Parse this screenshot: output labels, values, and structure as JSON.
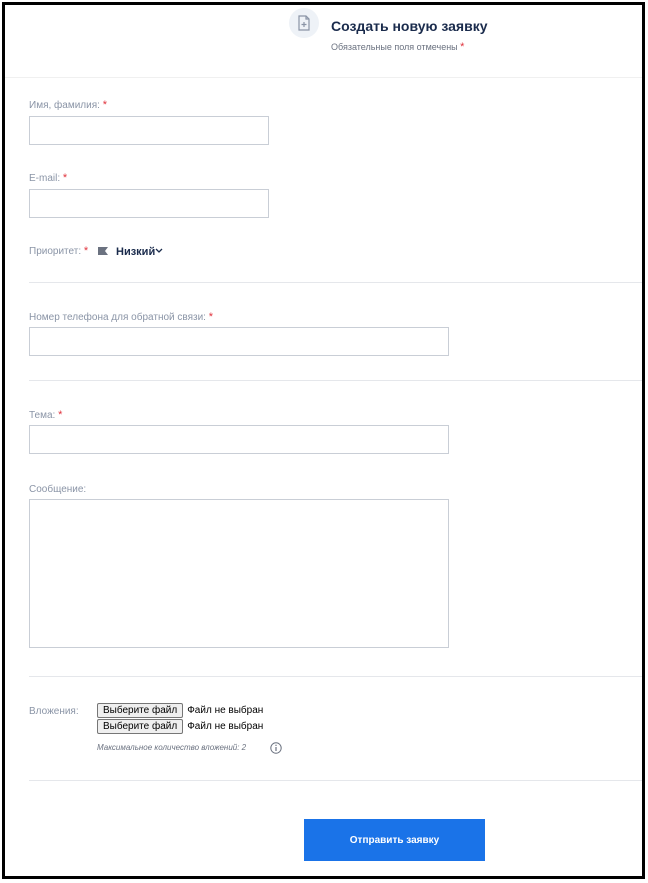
{
  "header": {
    "title": "Создать новую заявку",
    "subtitle": "Обязательные поля отмечены",
    "required_mark": "*"
  },
  "form": {
    "name": {
      "label": "Имя, фамилия:",
      "required": "*",
      "value": ""
    },
    "email": {
      "label": "E-mail:",
      "required": "*",
      "value": ""
    },
    "priority": {
      "label": "Приоритет:",
      "required": "*",
      "value": "Низкий",
      "flag_color": "#6b7280"
    },
    "phone": {
      "label": "Номер телефона для обратной связи:",
      "required": "*",
      "value": ""
    },
    "subject": {
      "label": "Тема:",
      "required": "*",
      "value": ""
    },
    "message": {
      "label": "Сообщение:",
      "value": ""
    },
    "attachments": {
      "label": "Вложения:",
      "files": [
        {
          "button": "Выберите файл",
          "status": "Файл не выбран"
        },
        {
          "button": "Выберите файл",
          "status": "Файл не выбран"
        }
      ],
      "max_note": "Максимальное количество вложений: 2"
    },
    "submit_label": "Отправить заявку"
  },
  "colors": {
    "accent": "#1a73e8",
    "required": "#e0323c",
    "title": "#1a2b4c"
  }
}
